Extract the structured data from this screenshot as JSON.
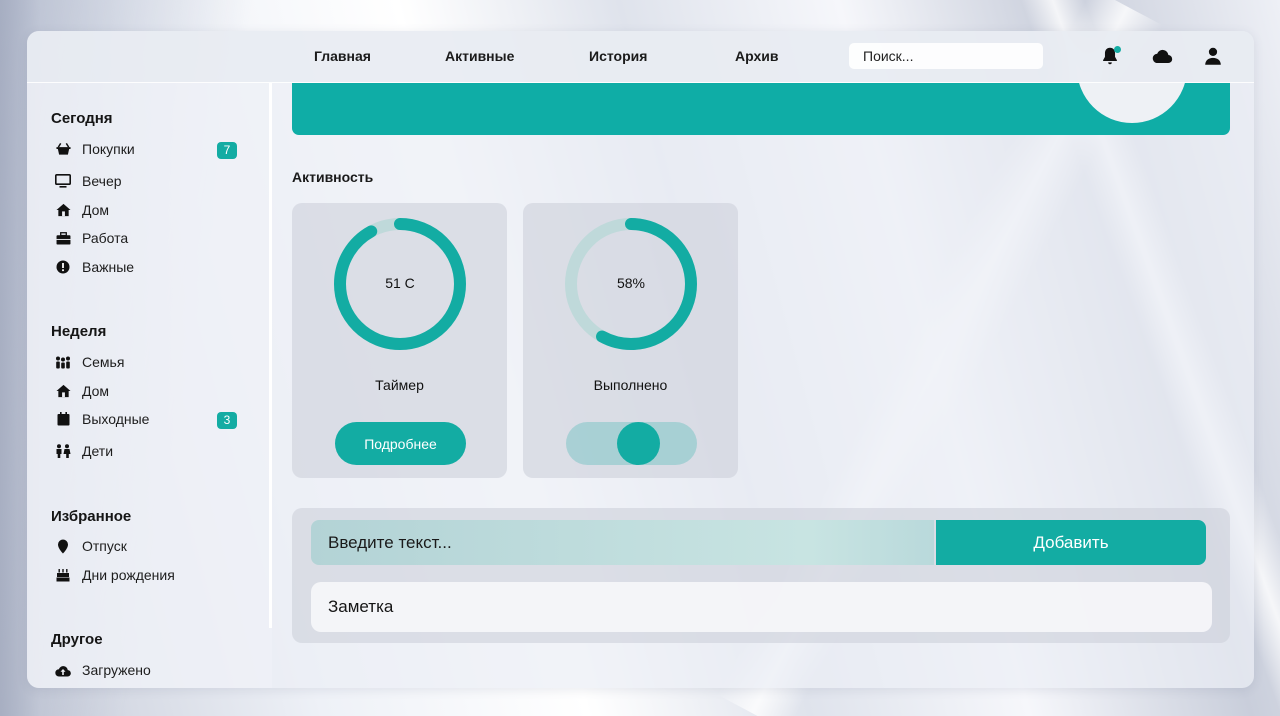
{
  "nav": {
    "links": [
      "Главная",
      "Активные",
      "История",
      "Архив"
    ],
    "search_placeholder": "Поиск..."
  },
  "icons": {
    "top": [
      "bell-icon",
      "cloud-icon",
      "user-icon"
    ],
    "notification_dot_color": "#13aca3"
  },
  "sidebar": {
    "sections": [
      {
        "title": "Сегодня",
        "items": [
          {
            "label": "Покупки",
            "icon": "basket-icon",
            "badge": "7"
          },
          {
            "label": "Вечер",
            "icon": "monitor-icon"
          },
          {
            "label": "Дом",
            "icon": "home-icon"
          },
          {
            "label": "Работа",
            "icon": "briefcase-icon"
          },
          {
            "label": "Важные",
            "icon": "exclamation-icon"
          }
        ]
      },
      {
        "title": "Неделя",
        "items": [
          {
            "label": "Семья",
            "icon": "family-icon"
          },
          {
            "label": "Дом",
            "icon": "home-icon"
          },
          {
            "label": "Выходные",
            "icon": "calendar-icon",
            "badge": "3"
          },
          {
            "label": "Дети",
            "icon": "children-icon"
          }
        ]
      },
      {
        "title": "Избранное",
        "items": [
          {
            "label": "Отпуск",
            "icon": "map-pin-icon"
          },
          {
            "label": "Дни рождения",
            "icon": "cake-icon"
          }
        ]
      },
      {
        "title": "Другое",
        "items": [
          {
            "label": "Загружено",
            "icon": "cloud-upload-icon"
          }
        ]
      }
    ]
  },
  "activity": {
    "title": "Активность",
    "cards": [
      {
        "value": "51 С",
        "progress": 0.92,
        "title": "Таймер",
        "button_label": "Подробнее"
      },
      {
        "value": "58%",
        "progress": 0.58,
        "title": "Выполнено",
        "toggle_on": true
      }
    ]
  },
  "input": {
    "placeholder": "Введите текст...",
    "add_label": "Добавить"
  },
  "notes": [
    "Заметка"
  ],
  "colors": {
    "accent": "#13aca3",
    "ring_track": "#bfd9da",
    "text": "#1b1b1b"
  }
}
